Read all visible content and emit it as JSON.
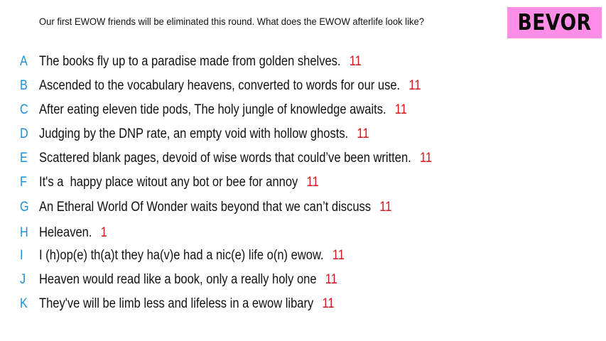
{
  "question": "Our first EWOW friends will be eliminated this round. What does the EWOW afterlife look like?",
  "badge": "BEVOR",
  "colors": {
    "letter": "#1f8fd3",
    "score": "#d4151b",
    "badge_bg": "#ff8fe6"
  },
  "entries": [
    {
      "letter": "A",
      "text": "The books fly up to a paradise made from golden shelves.",
      "score": "11"
    },
    {
      "letter": "B",
      "text": "Ascended to the vocabulary heavens, converted to words for our use.",
      "score": "11"
    },
    {
      "letter": "C",
      "text": "After eating eleven tide pods, The holy jungle of knowledge awaits.",
      "score": "11"
    },
    {
      "letter": "D",
      "text": "Judging by the DNP rate, an empty void with hollow ghosts.",
      "score": "11"
    },
    {
      "letter": "E",
      "text": "Scattered blank pages, devoid of wise words that could’ve been written.",
      "score": "11"
    },
    {
      "letter": "F",
      "text": "It's a  happy place witout any bot or bee for annoy",
      "score": "11"
    },
    {
      "letter": "G",
      "text": "An Etheral World Of Wonder waits beyond that we can’t discuss",
      "score": "11"
    },
    {
      "letter": "H",
      "text": "Heleaven.",
      "score": "1"
    },
    {
      "letter": "I",
      "text": "I (h)op(e) th(a)t they ha(v)e had a nic(e) life o(n) ewow.",
      "score": "11"
    },
    {
      "letter": "J",
      "text": "Heaven would read like a book, only a really holy one",
      "score": "11"
    },
    {
      "letter": "K",
      "text": "They've will be limb less and lifeless in a ewow libary",
      "score": "11"
    }
  ]
}
